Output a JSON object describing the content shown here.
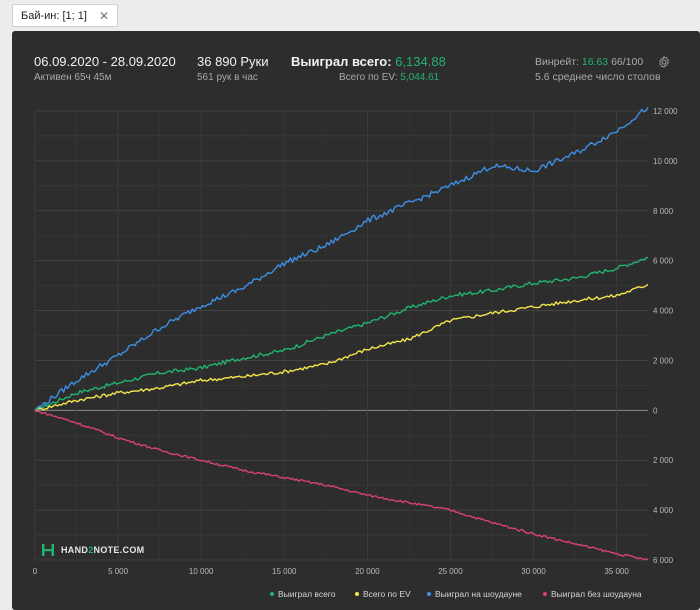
{
  "tab": {
    "label": "Бай-ин: [1; 1]",
    "close": "✕"
  },
  "header": {
    "date_range": "06.09.2020 - 28.09.2020",
    "active": "Активен 65ч 45м",
    "hands": "36 890 Руки",
    "hands_per_hour": "561 рук в час",
    "won_total_label": "Выиграл всего:",
    "won_total_value": "6,134.88",
    "ev_label": "Всего по EV:",
    "ev_value": "5,044.61",
    "winrate_label": "Винрейт:",
    "winrate_value": "16.63",
    "winrate_suffix": "66/100",
    "tables": "5.6 среднее число столов"
  },
  "logo": {
    "text_left": "HAND",
    "text_mid": "2",
    "text_right": "NOTE.COM"
  },
  "colors": {
    "green": "#21b36f",
    "yellow": "#f2e64a",
    "blue": "#3d8fe6",
    "red": "#d9436d",
    "background": "#2d2d2d"
  },
  "icons": {
    "settings": "gear-icon",
    "close": "close-icon"
  },
  "chart_data": {
    "type": "line",
    "x_ticks": [
      "0",
      "5 000",
      "10 000",
      "15 000",
      "20 000",
      "25 000",
      "30 000",
      "35 000"
    ],
    "y_ticks": [
      "12 000",
      "10 000",
      "8 000",
      "6 000",
      "4 000",
      "2 000",
      "0",
      "2 000",
      "4 000",
      "6 000"
    ],
    "y_tick_values": [
      12000,
      10000,
      8000,
      6000,
      4000,
      2000,
      0,
      -2000,
      -4000,
      -6000
    ],
    "xlim": [
      0,
      36890
    ],
    "ylim": [
      -6000,
      12000
    ],
    "y_axis_position": "right",
    "grid": true,
    "legend_position": "bottom-right",
    "x": [
      0,
      2500,
      5000,
      7500,
      10000,
      12500,
      15000,
      17500,
      20000,
      22500,
      25000,
      27500,
      30000,
      32500,
      35000,
      36890
    ],
    "series": [
      {
        "name": "Выиграл всего",
        "color": "#21b36f",
        "values": [
          0,
          700,
          1100,
          1500,
          1700,
          2100,
          2400,
          3000,
          3500,
          4100,
          4600,
          4800,
          5100,
          5300,
          5700,
          6135
        ]
      },
      {
        "name": "Всего по EV",
        "color": "#f2e64a",
        "values": [
          0,
          400,
          700,
          900,
          1200,
          1350,
          1550,
          1850,
          2450,
          2850,
          3600,
          3900,
          4150,
          4400,
          4600,
          5045
        ]
      },
      {
        "name": "Выиграл на шоудауне",
        "color": "#3d8fe6",
        "values": [
          0,
          1200,
          2200,
          3300,
          4200,
          4900,
          5900,
          6600,
          7600,
          8300,
          9000,
          9800,
          9600,
          10300,
          11200,
          12150
        ]
      },
      {
        "name": "Выиграл без шоудауна",
        "color": "#d9436d",
        "values": [
          0,
          -500,
          -1100,
          -1600,
          -2000,
          -2400,
          -2700,
          -3000,
          -3400,
          -3700,
          -4000,
          -4500,
          -4950,
          -5350,
          -5750,
          -6000
        ]
      }
    ]
  }
}
